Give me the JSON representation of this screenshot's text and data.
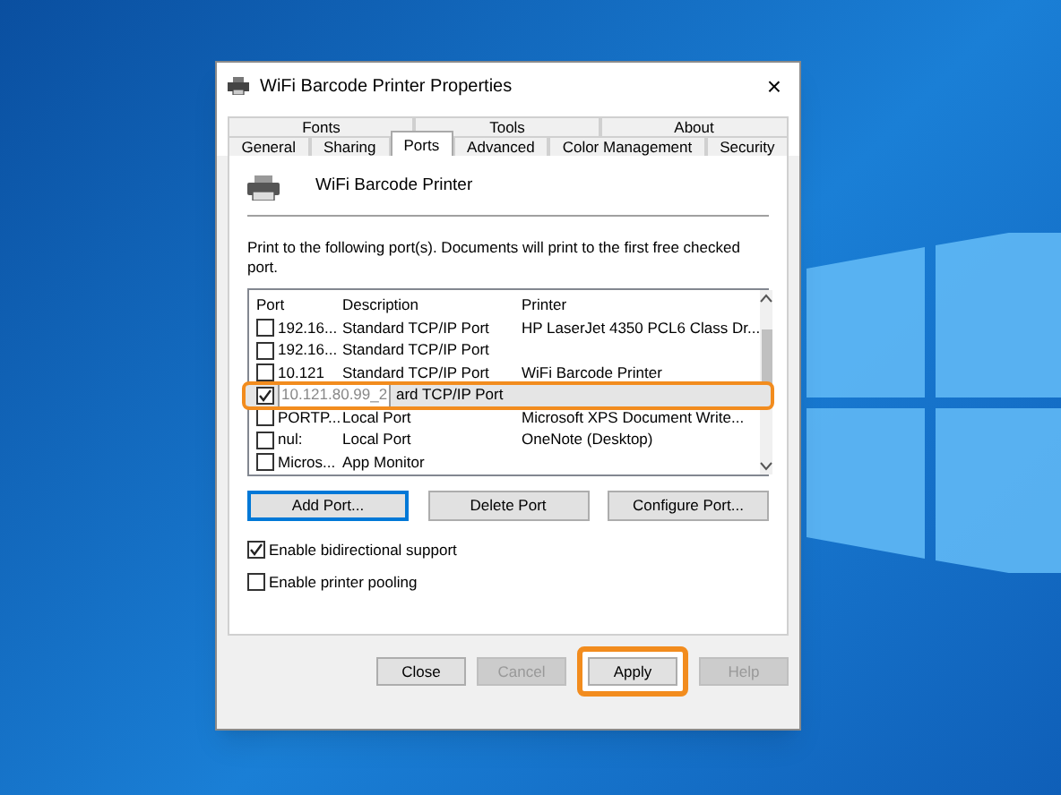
{
  "window": {
    "title": "WiFi Barcode Printer Properties",
    "close": "×"
  },
  "tab_rows": [
    [
      {
        "label": "Fonts",
        "selected": false
      },
      {
        "label": "Tools",
        "selected": false
      },
      {
        "label": "About",
        "selected": false
      }
    ],
    [
      {
        "label": "General",
        "selected": false
      },
      {
        "label": "Sharing",
        "selected": false
      },
      {
        "label": "Ports",
        "selected": true
      },
      {
        "label": "Advanced",
        "selected": false
      },
      {
        "label": "Color Management",
        "selected": false
      },
      {
        "label": "Security",
        "selected": false
      }
    ]
  ],
  "printer_name": "WiFi Barcode Printer",
  "instructions": "Print to the following port(s). Documents will print to the first free checked port.",
  "ports_table": {
    "columns": [
      "Port",
      "Description",
      "Printer"
    ],
    "rows": [
      {
        "port": "192.16...",
        "description": "Standard TCP/IP Port",
        "printer": "HP LaserJet 4350 PCL6 Class Dr...",
        "checked": false,
        "selected": false,
        "highlighted": false
      },
      {
        "port": "192.16...",
        "description": "Standard TCP/IP Port",
        "printer": "",
        "checked": false,
        "selected": false,
        "highlighted": false
      },
      {
        "port": "10.121",
        "description": "Standard TCP/IP Port",
        "printer": "WiFi Barcode Printer",
        "checked": false,
        "selected": false,
        "highlighted": false
      },
      {
        "port": "10.121.80.99_2",
        "description": "ard TCP/IP Port",
        "printer": "",
        "checked": true,
        "selected": true,
        "highlighted": true
      },
      {
        "port": "PORTP...",
        "description": "Local Port",
        "printer": "Microsoft XPS Document Write...",
        "checked": false,
        "selected": false,
        "highlighted": false
      },
      {
        "port": "nul:",
        "description": "Local Port",
        "printer": "OneNote (Desktop)",
        "checked": false,
        "selected": false,
        "highlighted": false
      },
      {
        "port": "Micros...",
        "description": "App Monitor",
        "printer": "",
        "checked": false,
        "selected": false,
        "highlighted": false
      }
    ]
  },
  "port_buttons": [
    {
      "label": "Add Port...",
      "focused": true
    },
    {
      "label": "Delete Port",
      "focused": false
    },
    {
      "label": "Configure Port...",
      "focused": false
    }
  ],
  "options": [
    {
      "label": "Enable bidirectional support",
      "checked": true
    },
    {
      "label": "Enable printer pooling",
      "checked": false
    }
  ],
  "footer_buttons": [
    {
      "label": "Close",
      "disabled": false,
      "highlighted": false
    },
    {
      "label": "Cancel",
      "disabled": true,
      "highlighted": false
    },
    {
      "label": "Apply",
      "disabled": false,
      "highlighted": true
    },
    {
      "label": "Help",
      "disabled": true,
      "highlighted": false
    }
  ]
}
